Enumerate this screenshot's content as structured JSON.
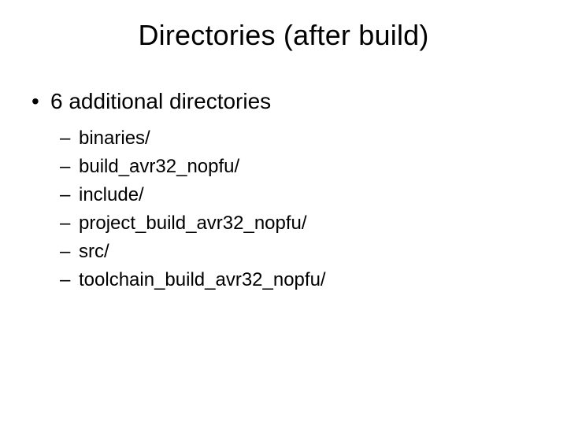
{
  "title": "Directories (after build)",
  "main_bullet": "6 additional directories",
  "items": [
    "binaries/",
    "build_avr32_nopfu/",
    "include/",
    "project_build_avr32_nopfu/",
    "src/",
    "toolchain_build_avr32_nopfu/"
  ]
}
